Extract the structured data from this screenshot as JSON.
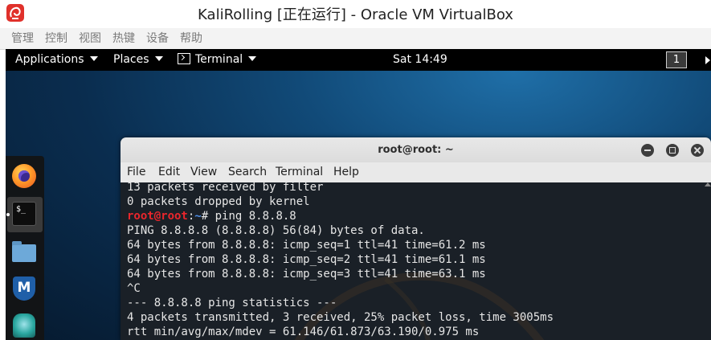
{
  "host_window": {
    "title": "KaliRolling [正在运行] - Oracle VM VirtualBox",
    "menu": [
      "管理",
      "控制",
      "视图",
      "热键",
      "设备",
      "帮助"
    ]
  },
  "gnome_topbar": {
    "applications_label": "Applications",
    "places_label": "Places",
    "terminal_label": "Terminal",
    "clock": "Sat 14:49",
    "workspace_number": "1"
  },
  "dock": {
    "items": [
      "firefox-icon",
      "terminal-icon",
      "files-icon",
      "metasploit-icon",
      "armitage-icon"
    ],
    "terminal_glyph": "$_",
    "metasploit_glyph": "M"
  },
  "terminal": {
    "title": "root@root: ~",
    "menu": [
      "File",
      "Edit",
      "View",
      "Search",
      "Terminal",
      "Help"
    ],
    "lines": {
      "l0": "13 packets received by filter",
      "l1": "0 packets dropped by kernel",
      "prompt_user": "root@root",
      "prompt_colon": ":",
      "prompt_path": "~",
      "prompt_cmd": "# ping 8.8.8.8",
      "l3": "PING 8.8.8.8 (8.8.8.8) 56(84) bytes of data.",
      "l4": "64 bytes from 8.8.8.8: icmp_seq=1 ttl=41 time=61.2 ms",
      "l5": "64 bytes from 8.8.8.8: icmp_seq=2 ttl=41 time=61.1 ms",
      "l6": "64 bytes from 8.8.8.8: icmp_seq=3 ttl=41 time=63.1 ms",
      "l7": "^C",
      "l8": "--- 8.8.8.8 ping statistics ---",
      "l9": "4 packets transmitted, 3 received, 25% packet loss, time 3005ms",
      "l10": "rtt min/avg/max/mdev = 61.146/61.873/63.190/0.975 ms"
    }
  },
  "colors": {
    "prompt_user": "#e8262c",
    "prompt_path": "#4f8fe8",
    "terminal_bg": "#1a2027",
    "topbar_bg": "#000000"
  }
}
